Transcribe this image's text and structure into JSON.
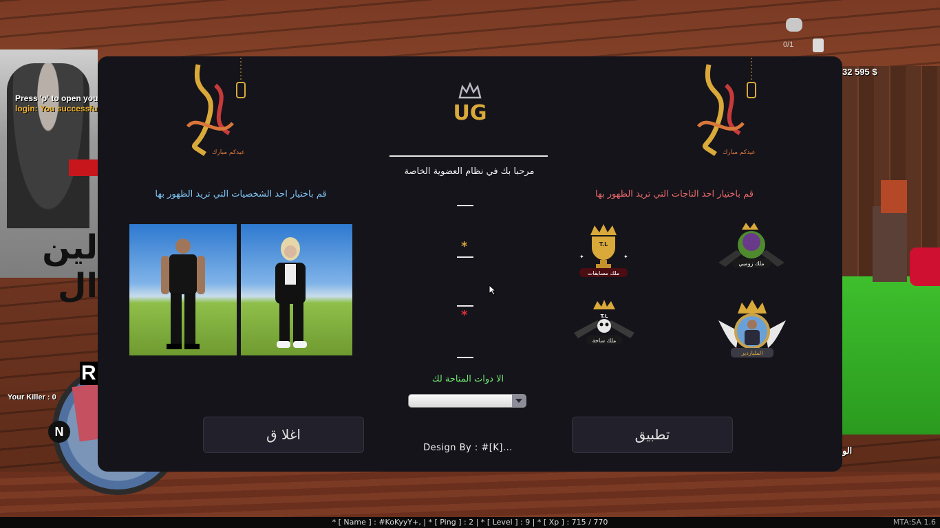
{
  "hud": {
    "money": "32 595 $",
    "ammo": "0/1",
    "your_killer": "Your Killer : 0",
    "press_p": "Press 'p' to open your",
    "login_msg": "login: You successfull",
    "radar_north": "N",
    "radar_letter": "R",
    "right_partial": "الو",
    "poster_text": "لين ال",
    "status_bar": "* [ Name ] : #KoKyyY+, | * [ Ping ] : 2 | * [ Level ] : 9 | * [ Xp ] : 715 / 770",
    "version": "MTA:SA 1.6"
  },
  "panel": {
    "welcome": "مرحبا بك في نظام العضوية الخاصة",
    "choose_character": "قم باختيار احد الشخصيات التي تريد الظهور بها",
    "choose_crown": "قم باختيار احد التاجات التي تريد الظهور بها",
    "tools_label": "الا دوات المتاحة لك",
    "tools_selected": "",
    "apply_button": "تطبيق",
    "close_button": "اغلا ق",
    "design_by": "Design By : #[K]...",
    "logo_text": "UG",
    "eid_text": "عيدكم مبارك",
    "star_gold": "*",
    "star_red": "*",
    "crowns": [
      {
        "label": "ملك زومبي"
      },
      {
        "label": "ملك مسابقات",
        "badge": "T.L"
      },
      {
        "label": "الملياردير"
      },
      {
        "label": "ملك ساحة",
        "badge": "T.L"
      }
    ]
  },
  "colors": {
    "panel_bg": "#15141b",
    "character_header": "#7fc4f2",
    "crown_header": "#e86a6a",
    "tools_label": "#6ee46e",
    "gold": "#d9a93a",
    "accent_red": "#e0313a"
  }
}
